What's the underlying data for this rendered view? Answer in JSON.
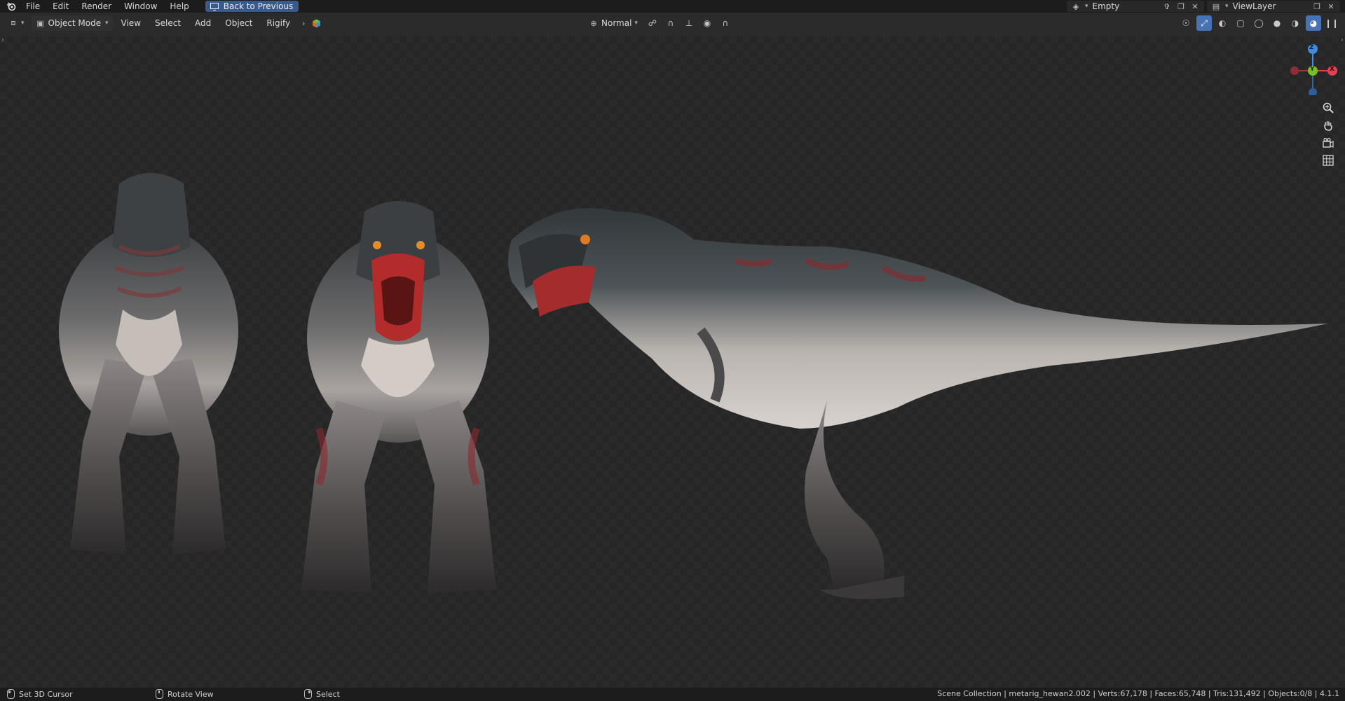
{
  "topbar": {
    "menus": [
      "File",
      "Edit",
      "Render",
      "Window",
      "Help"
    ],
    "back_button": "Back to Previous",
    "scene_name": "Empty",
    "view_layer": "ViewLayer"
  },
  "header": {
    "mode": "Object Mode",
    "menus": [
      "View",
      "Select",
      "Add",
      "Object",
      "Rigify"
    ],
    "orientation": "Normal"
  },
  "gizmo": {
    "z": "Z",
    "y": "Y",
    "x": "X"
  },
  "icons": {
    "zoom": "zoom-icon",
    "pan": "hand-icon",
    "camera": "camera-icon",
    "grid": "grid-icon"
  },
  "statusbar": {
    "left": "Set 3D Cursor",
    "middle": "Rotate View",
    "right": "Select",
    "stats": "Scene Collection | metarig_hewan2.002 | Verts:67,178 | Faces:65,748 | Tris:131,492 | Objects:0/8 | 4.1.1"
  },
  "colors": {
    "accent": "#4772b3",
    "axis_x": "#e0404f",
    "axis_y": "#74c21f",
    "axis_z": "#3d8ee0"
  }
}
